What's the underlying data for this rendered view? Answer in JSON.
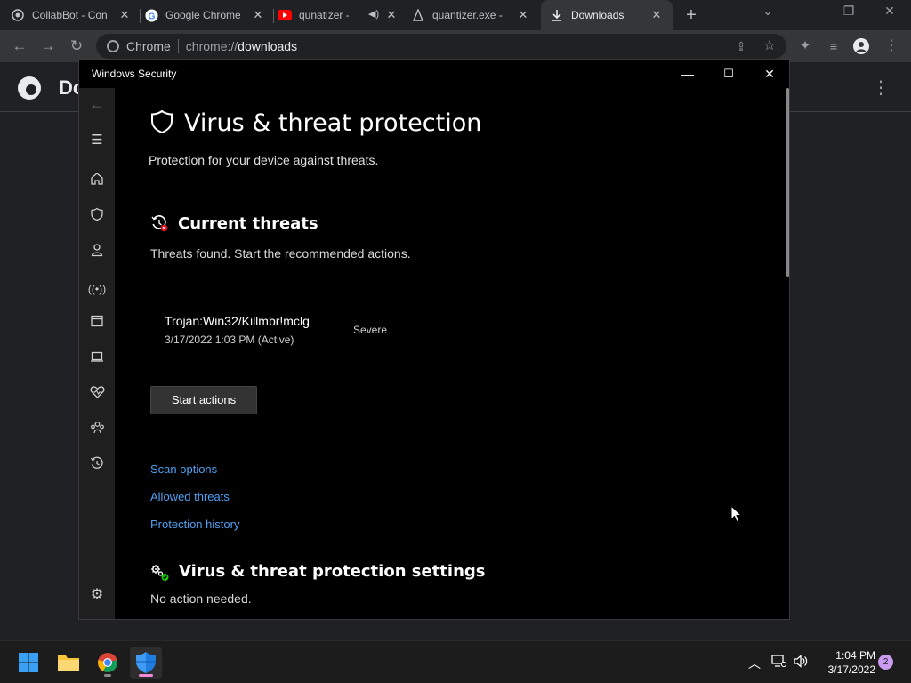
{
  "browser": {
    "tabs": [
      {
        "title": "CollabBot - Con",
        "icon": "collabbot-icon"
      },
      {
        "title": "Google Chrome",
        "icon": "google-icon"
      },
      {
        "title": "qunatizer -",
        "icon": "youtube-icon"
      },
      {
        "title": "quantizer.exe -",
        "icon": "file-icon"
      },
      {
        "title": "Downloads",
        "icon": "download-icon"
      }
    ],
    "address": {
      "site_label": "Chrome",
      "scheme": "chrome://",
      "host": "downloads"
    },
    "page_title": "Do"
  },
  "security_window": {
    "title": "Windows Security",
    "page_title": "Virus & threat protection",
    "page_subtitle": "Protection for your device against threats.",
    "current_threats": {
      "heading": "Current threats",
      "note": "Threats found. Start the recommended actions.",
      "threat": {
        "name": "Trojan:Win32/Killmbr!mclg",
        "date": "3/17/2022 1:03 PM (Active)",
        "severity": "Severe"
      },
      "start_button": "Start actions",
      "links": [
        "Scan options",
        "Allowed threats",
        "Protection history"
      ]
    },
    "settings": {
      "heading": "Virus & threat protection settings",
      "note": "No action needed."
    },
    "accent_link_color": "#4ea1f3",
    "threat_badge_color": "#e81123",
    "ok_badge_color": "#16c60c"
  },
  "taskbar": {
    "time": "1:04 PM",
    "date": "3/17/2022",
    "notification_count": "2"
  }
}
